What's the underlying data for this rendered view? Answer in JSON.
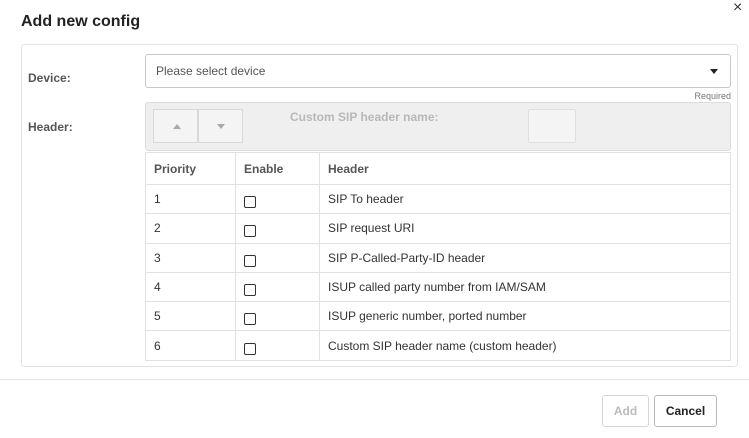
{
  "dialog": {
    "title": "Add new config",
    "close_glyph": "×"
  },
  "form": {
    "device_label": "Device:",
    "device_placeholder": "Please select device",
    "required_note": "Required",
    "header_label": "Header:",
    "custom_sip_header_label": "Custom SIP header name:"
  },
  "table": {
    "columns": [
      "Priority",
      "Enable",
      "Header"
    ],
    "rows": [
      {
        "priority": "1",
        "enabled": false,
        "header": "SIP To header"
      },
      {
        "priority": "2",
        "enabled": false,
        "header": "SIP request URI"
      },
      {
        "priority": "3",
        "enabled": false,
        "header": "SIP P-Called-Party-ID header"
      },
      {
        "priority": "4",
        "enabled": false,
        "header": "ISUP called party number from IAM/SAM"
      },
      {
        "priority": "5",
        "enabled": false,
        "header": "ISUP generic number, ported number"
      },
      {
        "priority": "6",
        "enabled": false,
        "header": "Custom SIP header name (custom header)"
      }
    ]
  },
  "footer": {
    "add_label": "Add",
    "cancel_label": "Cancel"
  },
  "icons": {
    "close": "close-icon",
    "dropdown": "caret-down-icon",
    "move_up": "arrow-up-icon",
    "move_down": "arrow-down-icon"
  }
}
